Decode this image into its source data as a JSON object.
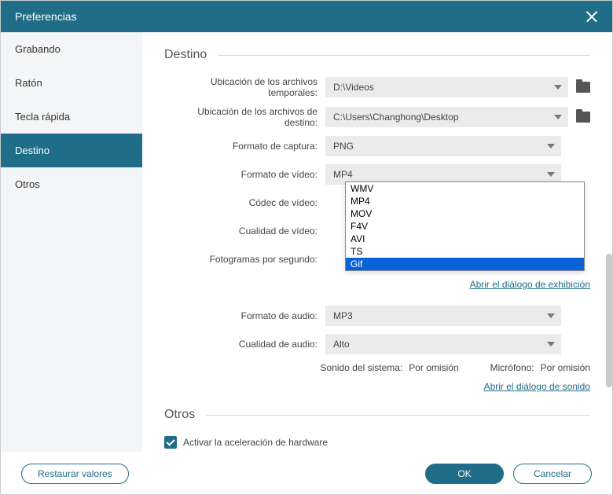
{
  "title": "Preferencias",
  "sidebar": {
    "items": [
      {
        "label": "Grabando"
      },
      {
        "label": "Ratón"
      },
      {
        "label": "Tecla rápida"
      },
      {
        "label": "Destino"
      },
      {
        "label": "Otros"
      }
    ],
    "activeIndex": 3
  },
  "section_destino": {
    "title": "Destino",
    "temp_label": "Ubicación de los archivos temporales:",
    "temp_value": "D:\\Videos",
    "dest_label": "Ubicación de los archivos de destino:",
    "dest_value": "C:\\Users\\Changhong\\Desktop",
    "capture_format_label": "Formato de captura:",
    "capture_format_value": "PNG",
    "video_format_label": "Formato de vídeo:",
    "video_format_value": "MP4",
    "video_codec_label": "Códec de vídeo:",
    "video_quality_label": "Cualidad de vídeo:",
    "fps_label": "Fotogramas por segundo:",
    "open_display_link": "Abrir el diálogo de exhibición",
    "audio_format_label": "Formato de audio:",
    "audio_format_value": "MP3",
    "audio_quality_label": "Cualidad de audio:",
    "audio_quality_value": "Alto",
    "system_sound_label": "Sonido del sistema:",
    "system_sound_value": "Por omisión",
    "mic_label": "Micrófono:",
    "mic_value": "Por omisión",
    "open_sound_link": "Abrir el diálogo de sonido"
  },
  "video_format_options": [
    "WMV",
    "MP4",
    "MOV",
    "F4V",
    "AVI",
    "TS",
    "Gif"
  ],
  "video_format_selected": "Gif",
  "section_otros": {
    "title": "Otros",
    "hw_accel_label": "Activar la aceleración de hardware"
  },
  "footer": {
    "restore": "Restaurar valores",
    "ok": "OK",
    "cancel": "Cancelar"
  }
}
